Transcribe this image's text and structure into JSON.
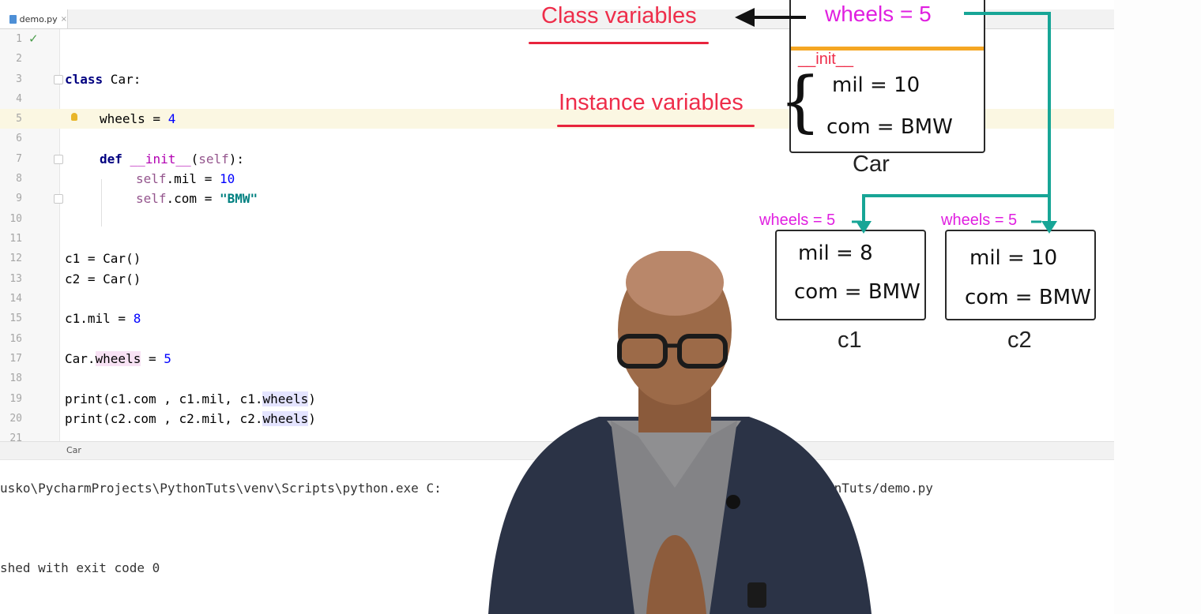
{
  "tab": {
    "filename": "demo.py",
    "close": "×"
  },
  "code_lines": [
    {
      "n": "1"
    },
    {
      "n": "2"
    },
    {
      "n": "3"
    },
    {
      "n": "4"
    },
    {
      "n": "5"
    },
    {
      "n": "6"
    },
    {
      "n": "7"
    },
    {
      "n": "8"
    },
    {
      "n": "9"
    },
    {
      "n": "10"
    },
    {
      "n": "11"
    },
    {
      "n": "12"
    },
    {
      "n": "13"
    },
    {
      "n": "14"
    },
    {
      "n": "15"
    },
    {
      "n": "16"
    },
    {
      "n": "17"
    },
    {
      "n": "18"
    },
    {
      "n": "19"
    },
    {
      "n": "20"
    },
    {
      "n": "21"
    }
  ],
  "code": {
    "l3_kw": "class",
    "l3_rest": " Car:",
    "l5_a": "wheels",
    "l5_b": " = ",
    "l5_c": "4",
    "l7_kw": "def",
    "l7_fn": "__init__",
    "l7_a": "(",
    "l7_self": "self",
    "l7_b": "):",
    "l8_self": "self",
    "l8_a": ".mil = ",
    "l8_num": "10",
    "l9_self": "self",
    "l9_a": ".com = ",
    "l9_str": "\"BMW\"",
    "l12": "c1 = Car()",
    "l13": "c2 = Car()",
    "l15_a": "c1.mil = ",
    "l15_num": "8",
    "l17_a": "Car.",
    "l17_b": "wheels",
    "l17_c": " = ",
    "l17_num": "5",
    "l19_a": "print(c1.com , c1.mil, c1.",
    "l19_b": "wheels",
    "l19_c": ")",
    "l20_a": "print(c2.com , c2.mil, c2.",
    "l20_b": "wheels",
    "l20_c": ")"
  },
  "breadcrumb": "Car",
  "console": {
    "line1_left": "usko\\PycharmProjects\\PythonTuts\\venv\\Scripts\\python.exe C:",
    "line1_right": "onTuts/demo.py",
    "line2": "shed with exit code 0"
  },
  "diagram": {
    "class_variables": "Class variables",
    "instance_variables": "Instance variables",
    "car_wheels": "wheels = 5",
    "init_label": "__init__",
    "car_mil": "mil  = 10",
    "car_com": "com = BMW",
    "car_label": "Car",
    "c1_wheels": "wheels = 5",
    "c2_wheels": "wheels = 5",
    "c1_mil": "mil  = 8",
    "c1_com": "com = BMW",
    "c2_mil": "mil  = 10",
    "c2_com": "com = BMW",
    "c1_label": "c1",
    "c2_label": "c2",
    "colors": {
      "red": "#ee2d4a",
      "magenta": "#e01fe0",
      "teal": "#17a596",
      "orange": "#f5a623"
    }
  }
}
